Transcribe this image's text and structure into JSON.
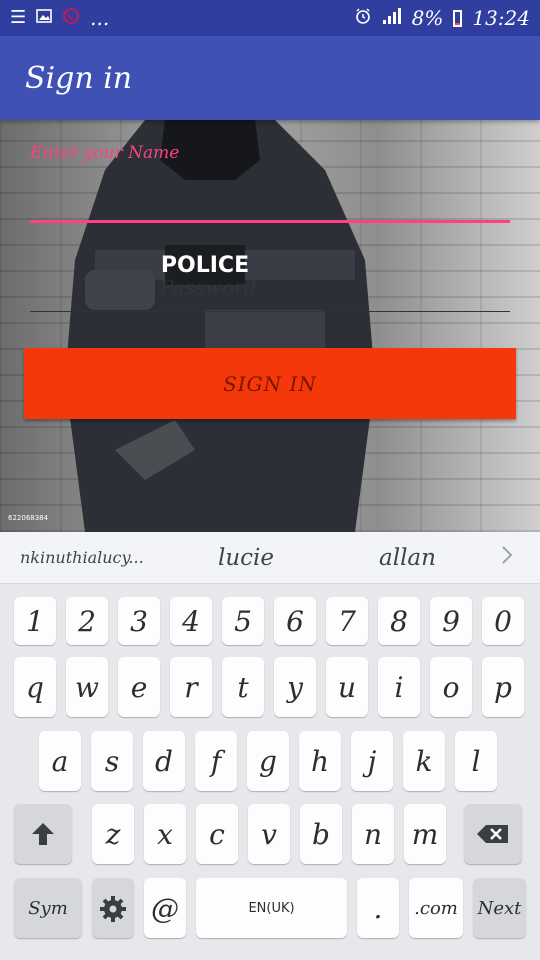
{
  "status_bar": {
    "icons_left": [
      "list-icon",
      "image-icon",
      "whatsapp-icon",
      "more-dots-icon"
    ],
    "more_dots": "...",
    "icons_right": [
      "alarm-icon",
      "signal-icon",
      "battery-icon"
    ],
    "battery": "8%",
    "time": "13:24",
    "battery_color": "#ff4444"
  },
  "app_bar": {
    "title": "Sign in",
    "color": "#3f51b5"
  },
  "background": {
    "badge_text": "POLICE",
    "image_id": "622068384"
  },
  "form": {
    "name_placeholder": "Enter your Name",
    "password_placeholder": "Password",
    "accent_color": "#ff4081",
    "signin_button": "SIGN IN",
    "signin_color": "#f4380a"
  },
  "suggestions": [
    "nkinuthialucy...",
    "lucie",
    "allan"
  ],
  "keyboard": {
    "row_numbers": [
      "1",
      "2",
      "3",
      "4",
      "5",
      "6",
      "7",
      "8",
      "9",
      "0"
    ],
    "row_1": [
      "q",
      "w",
      "e",
      "r",
      "t",
      "y",
      "u",
      "i",
      "o",
      "p"
    ],
    "row_2": [
      "a",
      "s",
      "d",
      "f",
      "g",
      "h",
      "j",
      "k",
      "l"
    ],
    "row_3": [
      "z",
      "x",
      "c",
      "v",
      "b",
      "n",
      "m"
    ],
    "sym": "Sym",
    "at": "@",
    "space": "EN(UK)",
    "period": ".",
    "dotcom": ".com",
    "next": "Next"
  }
}
